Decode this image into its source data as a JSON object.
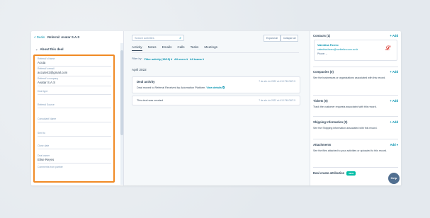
{
  "breadcrumb": {
    "back_label": "< Deals",
    "deal_title": "Referral: Avatar S.A.S"
  },
  "about": {
    "heading": "About this deal",
    "fields": [
      {
        "label": "Referral's Name",
        "value": "Acuta"
      },
      {
        "label": "Referral's email",
        "value": "accuteri2@gmail.com"
      },
      {
        "label": "Referral's company",
        "value": "Avatar S.A.S"
      },
      {
        "label": "Deal type",
        "value": ""
      },
      {
        "label": "Referral Source",
        "value": ""
      },
      {
        "label": "Consultant Name",
        "value": ""
      },
      {
        "label": "Sent to",
        "value": ""
      },
      {
        "label": "Close date",
        "value": ""
      },
      {
        "label": "Deal owner",
        "value": "Elise Reyes"
      },
      {
        "label": "Comments from partner",
        "value": ""
      }
    ]
  },
  "activity": {
    "search_placeholder": "Search activities",
    "expand_all": "Expand all",
    "collapse_all": "Collapse all",
    "tabs": [
      "Activity",
      "Notes",
      "Emails",
      "Calls",
      "Tasks",
      "Meetings"
    ],
    "filter_prefix": "Filter by:",
    "filter_activity": "Filter activity (15/15) ▾",
    "filter_users": "All users ▾",
    "filter_teams": "All teams ▾",
    "month": "April 2022",
    "items": [
      {
        "title": "Deal activity",
        "body": "Deal moved to Referral Received by Automation Platform.",
        "link": "View details ⧉",
        "date": "7 de abr. de 2022 at 4:13 PM GMT-5"
      },
      {
        "title": "",
        "body": "This deal was created",
        "link": "",
        "date": "7 de abr. de 2022 at 4:13 PM GMT-5"
      }
    ]
  },
  "sidebar": {
    "contacts": {
      "title": "Contacts (1)",
      "add": "+ Add",
      "name": "Valentina Forero",
      "email": "valentina.forero@northeliza.com.au ⧉",
      "phone": "Phone: --"
    },
    "companies": {
      "title": "Companies (0)",
      "add": "+ Add",
      "body": "See the businesses or organizations associated with this record."
    },
    "tickets": {
      "title": "Tickets (0)",
      "add": "+ Add",
      "body": "Track the customer requests associated with this record."
    },
    "shipping": {
      "title": "Shipping Information (0)",
      "add": "+ Add",
      "body": "See the Shipping information associated with this record."
    },
    "attachments": {
      "title": "Attachments",
      "add": "Add ▾",
      "body": "See the files attached to your activities or uploaded to this record."
    },
    "attribution": {
      "title": "Deal create attribution",
      "badge": "NEW"
    }
  },
  "help_label": "Help",
  "colors": {
    "highlight": "#f08a24",
    "link": "#0091ae",
    "text": "#33475b",
    "badge": "#00bda5"
  }
}
